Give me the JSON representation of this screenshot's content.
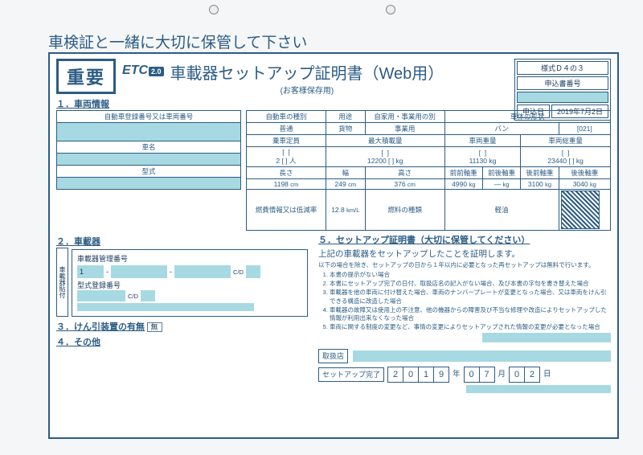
{
  "warn": "車検証と一緒に大切に保管して下さい",
  "important": "重要",
  "logo": "ETC",
  "ver": "2.0",
  "title": "車載器セットアップ証明書（Web用）",
  "subtitle": "(お客様保存用)",
  "form_no_label": "様式Ｄ４の３",
  "appno_label": "申込書番号",
  "appdate_label": "申込日",
  "appdate": "2019年7月2日",
  "sec1": "１．車両情報",
  "reg_label": "自動車登録番号又は車両番号",
  "name_label": "車名",
  "model_label": "型式",
  "kind_label": "自動車の種別",
  "kind": "普通",
  "use_label": "用途",
  "use": "貨物",
  "purpose_label": "自家用・事業用の別",
  "purpose": "事業用",
  "shape_label": "車体の形状",
  "shape": "バン",
  "shape_code": "[021]",
  "cap_label": "乗車定員",
  "cap_val": "2",
  "cap_unit": "人",
  "load_label": "最大積載量",
  "load_val": "12200",
  "load_unit": "kg",
  "weight_label": "車両重量",
  "weight_val": "11130",
  "weight_unit": "kg",
  "gross_label": "車両総重量",
  "gross_val": "23440",
  "gross_unit": "kg",
  "len_label": "長さ",
  "len_val": "1198",
  "len_unit": "cm",
  "wid_label": "幅",
  "wid_val": "249",
  "wid_unit": "cm",
  "hei_label": "高さ",
  "hei_val": "376",
  "hei_unit": "cm",
  "faxle_label": "前前軸重",
  "faxle_val": "4990",
  "faxle_unit": "kg",
  "fraxle_label": "前後軸重",
  "fraxle_val": "—",
  "fraxle_unit": "kg",
  "rfaxle_label": "後前軸重",
  "rfaxle_val": "3100",
  "rfaxle_unit": "kg",
  "rraxle_label": "後後軸重",
  "rraxle_val": "3040",
  "rraxle_unit": "kg",
  "eco_label": "燃費情報又は低減率",
  "eco_val": "12.8",
  "eco_unit": "km/L",
  "fuel_label": "燃料の種類",
  "fuel": "軽油",
  "sec2": "２．車載器",
  "sticker": "車載器貼付",
  "devno_label": "車載器管理番号",
  "devno_first": "1",
  "devmodel_label": "型式登録番号",
  "cd": "C/D",
  "sec3": "３．けん引装置の有無",
  "none": "無",
  "sec4": "４．その他",
  "sec5": "５．セットアップ証明書（大切に保管してください）",
  "cert_head": "上記の車載器をセットアップしたことを証明します。",
  "cert_sub": "以下の場合を除き、セットアップの日から１年以内に必要となった再セットアップは無料で行います。",
  "cert1": "本書の提示がない場合",
  "cert2": "本書にセットアップ完了の日付、取扱店名の記入がない場合、及び本書の字句を書き替えた場合",
  "cert3": "車載器を他の車両に付け替えた場合、車両のナンバープレートが変更となった場合、又は車両をけん引できる構造に改造した場合",
  "cert4": "車載器の故障又は使用上の不注意、他の機器からの障害及び不当な修理や改造によりセットアップした情報が利用出来なくなった場合",
  "cert5": "車両に関する制度の変更など、事情の変更によりセットアップされた情報の変更が必要となった場合",
  "shop_label": "取扱店",
  "comp_label": "セットアップ完了",
  "yy": "年",
  "mm": "月",
  "dd": "日",
  "y0": "2",
  "y1": "0",
  "y2": "1",
  "y3": "9",
  "m0": "0",
  "m1": "7",
  "d0": "0",
  "d1": "2"
}
